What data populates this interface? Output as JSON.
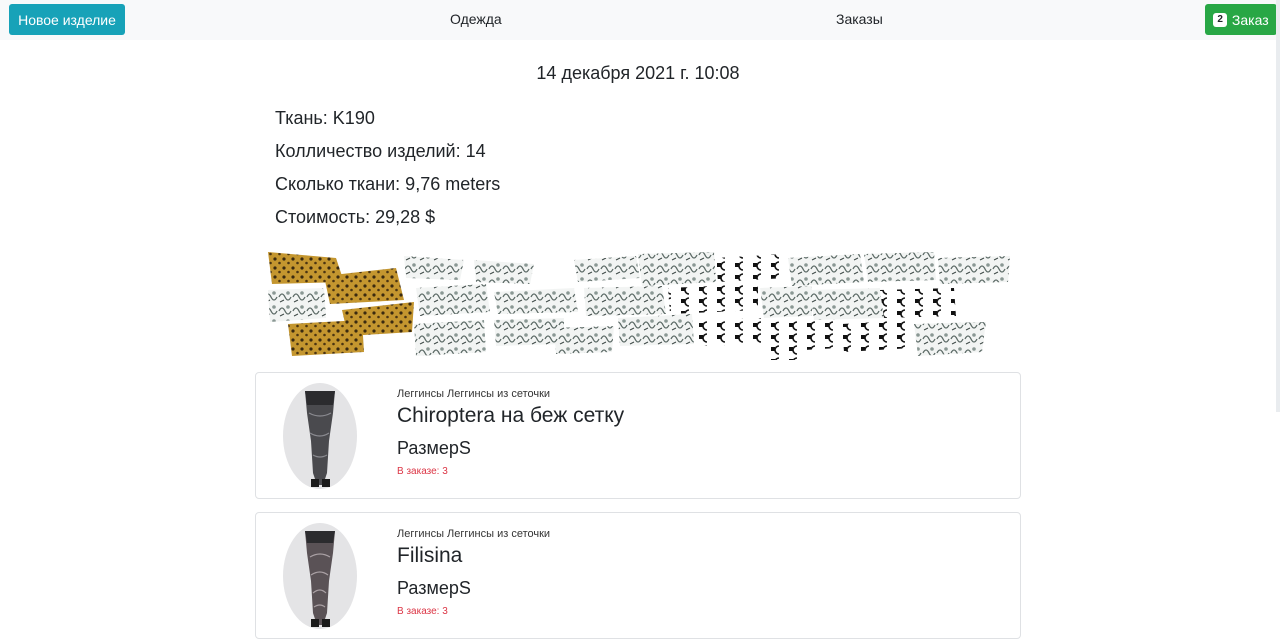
{
  "navbar": {
    "new_item_label": "Новое изделие",
    "links": [
      "Одежда",
      "Заказы"
    ],
    "order_button": {
      "badge": "2",
      "label": "Заказ"
    }
  },
  "order": {
    "date": "14 декабря 2021 г. 10:08",
    "fabric": "Ткань: K190",
    "quantity": "Колличество изделий: 14",
    "fabric_amount": "Сколько ткани: 9,76 meters",
    "cost": "Стоимость: 29,28 $"
  },
  "items": [
    {
      "category": "Леггинсы Леггинсы из сеточки",
      "name": "Chiroptera на беж сетку",
      "size": "РазмерS",
      "in_order": "В заказе: 3"
    },
    {
      "category": "Леггинсы Леггинсы из сеточки",
      "name": "Filisina",
      "size": "РазмерS",
      "in_order": "В заказе: 3"
    }
  ],
  "colors": {
    "primary_info": "#17a2b8",
    "success": "#28a745",
    "danger": "#dc3545",
    "leopard": "#b88a2c"
  }
}
